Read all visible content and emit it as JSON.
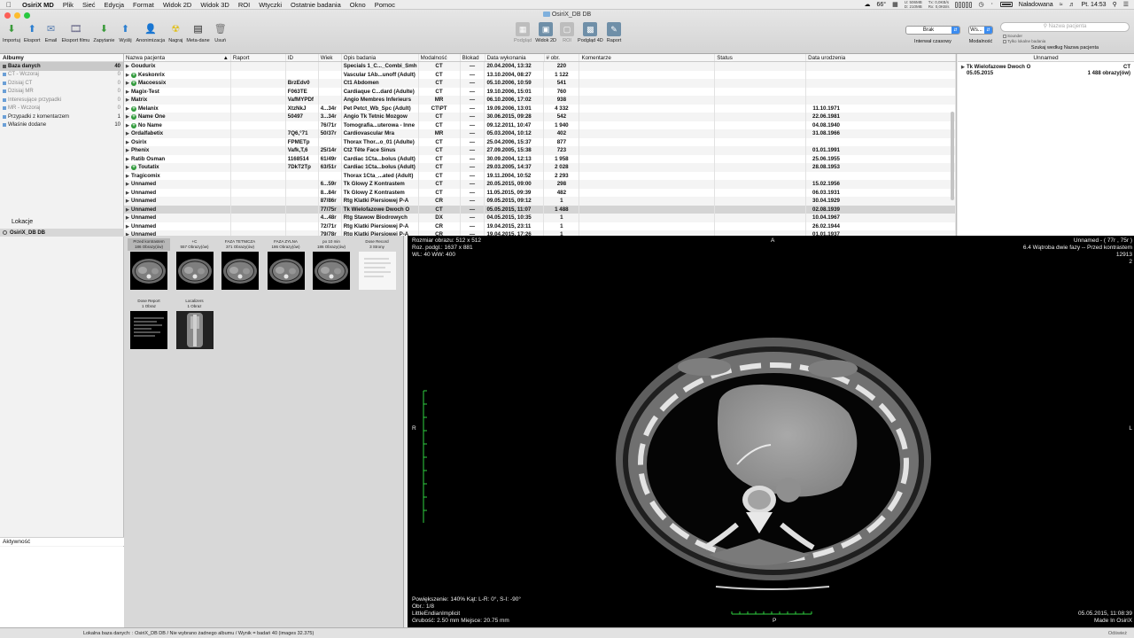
{
  "menubar": {
    "app_name": "OsiriX MD",
    "items": [
      "Plik",
      "Sieć",
      "Edycja",
      "Format",
      "Widok 2D",
      "Widok 3D",
      "ROI",
      "Wtyczki",
      "Ostatnie badania",
      "Okno",
      "Pomoc"
    ],
    "temperature": "66°",
    "net_up": "U: 506MB",
    "net_down": "D: 210MB",
    "net_tx": "Tx: 0,0KB/s",
    "net_rx": "Rx: 0,0KB/s",
    "battery_text": "Naładowana",
    "clock": "Pt. 14:53"
  },
  "window": {
    "title": "OsiriX_DB DB"
  },
  "toolbar": {
    "left": [
      {
        "label": "Importuj",
        "icon": "import-icon",
        "color": "#3a9a3a"
      },
      {
        "label": "Eksport",
        "icon": "export-icon",
        "color": "#2c7fd0"
      },
      {
        "label": "Email",
        "icon": "email-icon",
        "color": "#5a7fb0"
      },
      {
        "label": "Eksport filmu",
        "icon": "film-export-icon",
        "color": "#6b6b8a"
      },
      {
        "label": "Zapytanie",
        "icon": "query-icon",
        "color": "#3a9a3a"
      },
      {
        "label": "Wyślij",
        "icon": "send-icon",
        "color": "#2c7fd0"
      },
      {
        "label": "Anonimizacja",
        "icon": "anonymize-icon",
        "color": "#3a6fb0"
      },
      {
        "label": "Nagraj",
        "icon": "burn-icon",
        "color": "#e0c020"
      },
      {
        "label": "Meta-dane",
        "icon": "metadata-icon",
        "color": "#222222"
      },
      {
        "label": "Usuń",
        "icon": "trash-icon",
        "color": "#777777"
      }
    ],
    "center": [
      {
        "label": "Podgląd",
        "icon": "preview-icon",
        "dim": true
      },
      {
        "label": "Widok 2D",
        "icon": "viewer-2d-icon",
        "dim": false
      },
      {
        "label": "ROI",
        "icon": "roi-icon",
        "dim": true
      },
      {
        "label": "Podgląd 4D",
        "icon": "viewer-4d-icon",
        "dim": false
      },
      {
        "label": "Raport",
        "icon": "report-icon",
        "dim": false
      }
    ],
    "interval_value": "Brak",
    "interval_label": "Interwał czasowy",
    "modality_value": "Ws...",
    "modality_label": "Modalność",
    "search_placeholder": "Nazwa pacjenta",
    "search_opt1": "Sounder",
    "search_opt2": "Tylko lokalne badania",
    "search_label": "Szukaj według Nazwa pacjenta"
  },
  "sidebar": {
    "albums_title": "Albumy",
    "albums": [
      {
        "name": "Baza danych",
        "count": "40",
        "selected": true,
        "dim": false
      },
      {
        "name": "CT - Wczoraj",
        "count": "0",
        "selected": false,
        "dim": true
      },
      {
        "name": "Dzisiaj CT",
        "count": "0",
        "selected": false,
        "dim": true
      },
      {
        "name": "Dzisiaj MR",
        "count": "0",
        "selected": false,
        "dim": true
      },
      {
        "name": "Interesujące przypadki",
        "count": "0",
        "selected": false,
        "dim": true
      },
      {
        "name": "MR - Wczoraj",
        "count": "0",
        "selected": false,
        "dim": true
      },
      {
        "name": "Przypadki z komentarzem",
        "count": "1",
        "selected": false,
        "dim": false
      },
      {
        "name": "Właśnie dodane",
        "count": "10",
        "selected": false,
        "dim": false
      }
    ],
    "locations_title": "Lokacje",
    "location": "OsiriX_DB DB",
    "activity_title": "Aktywność"
  },
  "table": {
    "columns": [
      "Nazwa pacjenta",
      "Raport",
      "ID",
      "Wiek",
      "Opis badania",
      "Modalność",
      "Blokad",
      "Data wykonania",
      "# obr.",
      "Komentarze",
      "Status",
      "Data urodzenia"
    ],
    "rows": [
      {
        "name": "Goudurix",
        "plus": false,
        "id": "",
        "age": "",
        "desc": "Specials 1_C..._Combi_Smh",
        "mod": "CT",
        "lock": "—",
        "date": "20.04.2004, 13:32",
        "n": "220",
        "birth": "",
        "selected": false
      },
      {
        "name": "Keskonrix",
        "plus": true,
        "id": "",
        "age": "",
        "desc": "Vascular 1Ab...unoff (Adult)",
        "mod": "CT",
        "lock": "—",
        "date": "13.10.2004, 08:27",
        "n": "1 122",
        "birth": "",
        "selected": false
      },
      {
        "name": "Macoessix",
        "plus": true,
        "id": "BrzEdv0",
        "age": "",
        "desc": "Ct1 Abdomen",
        "mod": "CT",
        "lock": "—",
        "date": "05.10.2006, 10:59",
        "n": "541",
        "birth": "",
        "selected": false
      },
      {
        "name": "Magix-Test",
        "plus": false,
        "id": "F063TE",
        "age": "",
        "desc": "Cardiaque C...dard (Adulte)",
        "mod": "CT",
        "lock": "—",
        "date": "19.10.2006, 15:01",
        "n": "760",
        "birth": "",
        "selected": false
      },
      {
        "name": "Matrix",
        "plus": false,
        "id": "VafMYPDf",
        "age": "",
        "desc": "Angio Membres Inferieurs",
        "mod": "MR",
        "lock": "—",
        "date": "06.10.2006, 17:02",
        "n": "938",
        "birth": "",
        "selected": false
      },
      {
        "name": "Melanix",
        "plus": true,
        "id": "XtzNkJ",
        "age": "4...34r",
        "desc": "Pet Petct_Wb_Spc (Adult)",
        "mod": "CT\\PT",
        "lock": "—",
        "date": "19.09.2006, 13:01",
        "n": "4 332",
        "birth": "11.10.1971",
        "selected": false
      },
      {
        "name": "Name One",
        "plus": true,
        "id": "50497",
        "age": "3...34r",
        "desc": "Angio Tk Tetnic Mozgow",
        "mod": "CT",
        "lock": "—",
        "date": "30.06.2015, 09:28",
        "n": "542",
        "birth": "22.06.1981",
        "selected": false
      },
      {
        "name": "No Name",
        "plus": true,
        "id": "",
        "age": "76/71r",
        "desc": "Tomografia...uterowa - Inne",
        "mod": "CT",
        "lock": "—",
        "date": "09.12.2011, 10:47",
        "n": "1 940",
        "birth": "04.08.1940",
        "selected": false
      },
      {
        "name": "Ordalfabetix",
        "plus": false,
        "id": "7Q6,°71",
        "age": "50/37r",
        "desc": "Cardiovascular Mra",
        "mod": "MR",
        "lock": "—",
        "date": "05.03.2004, 10:12",
        "n": "402",
        "birth": "31.08.1966",
        "selected": false
      },
      {
        "name": "Osirix",
        "plus": false,
        "id": "FPMETp",
        "age": "",
        "desc": "Thorax Thor...o_01 (Adulte)",
        "mod": "CT",
        "lock": "—",
        "date": "25.04.2006, 15:37",
        "n": "877",
        "birth": "",
        "selected": false
      },
      {
        "name": "Phenix",
        "plus": false,
        "id": "Vafk,T,6",
        "age": "25/14r",
        "desc": "Ct2 Tête Face Sinus",
        "mod": "CT",
        "lock": "—",
        "date": "27.09.2005, 15:38",
        "n": "723",
        "birth": "01.01.1991",
        "selected": false
      },
      {
        "name": "Ratib Osman",
        "plus": false,
        "id": "1168514",
        "age": "61/49r",
        "desc": "Cardiac 1Cta...bolus (Adult)",
        "mod": "CT",
        "lock": "—",
        "date": "30.09.2004, 12:13",
        "n": "1 958",
        "birth": "25.06.1955",
        "selected": false
      },
      {
        "name": "Toutatix",
        "plus": true,
        "id": "7DkT2Tp",
        "age": "63/51r",
        "desc": "Cardiac 1Cta...bolus (Adult)",
        "mod": "CT",
        "lock": "—",
        "date": "29.03.2005, 14:37",
        "n": "2 028",
        "birth": "28.08.1953",
        "selected": false
      },
      {
        "name": "Tragicomix",
        "plus": false,
        "id": "",
        "age": "",
        "desc": "Thorax 1Cta_...ated (Adult)",
        "mod": "CT",
        "lock": "—",
        "date": "19.11.2004, 10:52",
        "n": "2 293",
        "birth": "",
        "selected": false
      },
      {
        "name": "Unnamed",
        "plus": false,
        "id": "",
        "age": "6...59r",
        "desc": "Tk Glowy Z Kontrastem",
        "mod": "CT",
        "lock": "—",
        "date": "20.05.2015, 09:00",
        "n": "298",
        "birth": "15.02.1956",
        "selected": false
      },
      {
        "name": "Unnamed",
        "plus": false,
        "id": "",
        "age": "8...84r",
        "desc": "Tk Glowy Z Kontrastem",
        "mod": "CT",
        "lock": "—",
        "date": "11.05.2015, 09:39",
        "n": "482",
        "birth": "06.03.1931",
        "selected": false
      },
      {
        "name": "Unnamed",
        "plus": false,
        "id": "",
        "age": "87/86r",
        "desc": "Rtg Klatki Piersiowej P-A",
        "mod": "CR",
        "lock": "—",
        "date": "09.05.2015, 09:12",
        "n": "1",
        "birth": "30.04.1929",
        "selected": false
      },
      {
        "name": "Unnamed",
        "plus": false,
        "id": "",
        "age": "77/75r",
        "desc": "Tk Wielofazowe Dwoch O",
        "mod": "CT",
        "lock": "—",
        "date": "05.05.2015, 11:07",
        "n": "1 488",
        "birth": "02.08.1939",
        "selected": true
      },
      {
        "name": "Unnamed",
        "plus": false,
        "id": "",
        "age": "4...48r",
        "desc": "Rtg Stawow Biodrowych",
        "mod": "DX",
        "lock": "—",
        "date": "04.05.2015, 10:35",
        "n": "1",
        "birth": "10.04.1967",
        "selected": false
      },
      {
        "name": "Unnamed",
        "plus": false,
        "id": "",
        "age": "72/71r",
        "desc": "Rtg Klatki Piersiowej P-A",
        "mod": "CR",
        "lock": "—",
        "date": "19.04.2015, 23:11",
        "n": "1",
        "birth": "26.02.1944",
        "selected": false
      },
      {
        "name": "Unnamed",
        "plus": false,
        "id": "",
        "age": "79/78r",
        "desc": "Rtg Klatki Piersiowej P-A",
        "mod": "CR",
        "lock": "—",
        "date": "19.04.2015, 17:26",
        "n": "1",
        "birth": "01.01.1937",
        "selected": false
      }
    ]
  },
  "preview": {
    "header": "Unnamed",
    "study": "Tk Wielofazowe Dwoch O",
    "modality": "CT",
    "date": "05.05.2015",
    "count": "1 488 obrazy(ów)"
  },
  "thumbnails": [
    {
      "title": "Przed kontrastem",
      "sub": "186 Obrazy(ów)",
      "kind": "ct",
      "selected": true
    },
    {
      "title": "+C",
      "sub": "557 Obrazy(ów)",
      "kind": "ct",
      "selected": false
    },
    {
      "title": "FAZA TETNICZA",
      "sub": "371 Obrazy(ów)",
      "kind": "ct",
      "selected": false
    },
    {
      "title": "FAZA ZYLNA",
      "sub": "186 Obrazy(ów)",
      "kind": "ct",
      "selected": false
    },
    {
      "title": "po 10 min",
      "sub": "186 Obrazy(ów)",
      "kind": "ct",
      "selected": false
    },
    {
      "title": "Dose Record",
      "sub": "3 Strony",
      "kind": "doc",
      "selected": false
    },
    {
      "title": "Dose Report",
      "sub": "1 Obraz",
      "kind": "report",
      "selected": false
    },
    {
      "title": "Localizers",
      "sub": "1 Obraz",
      "kind": "scout",
      "selected": false
    }
  ],
  "viewer": {
    "tl1": "Rozmiar obrazu: 512 x 512",
    "tl2": "Roz. podgl.: 1637 x 881",
    "tl3": "WL: 40 WW: 400",
    "tr1": "Unnamed - ( 77r , 75r )",
    "tr2": "6.4 Wątroba dwie fazy -- Przed kontrastem",
    "tr3": "12913",
    "tr4": "2",
    "bl1": "Powiększenie: 140% Kąt: L-R: 0°, S-I: -90°",
    "bl2": "Obr.: 1/8",
    "bl3": "LittleEndianImplicit",
    "bl4": "Grubość: 2.50 mm Miejsce: 20.75 mm",
    "br1": "05.05.2015, 11:08:39",
    "br2": "Made In OsiriX",
    "orient_top": "A",
    "orient_left": "R",
    "orient_bottom": "P",
    "orient_right": "L"
  },
  "statusbar": {
    "text": "Lokalna baza danych: : OsiriX_DB DB / Nie wybrano żadnego albumu / Wynik = badań 40  (images 32.375)",
    "right": "Odśwież"
  }
}
